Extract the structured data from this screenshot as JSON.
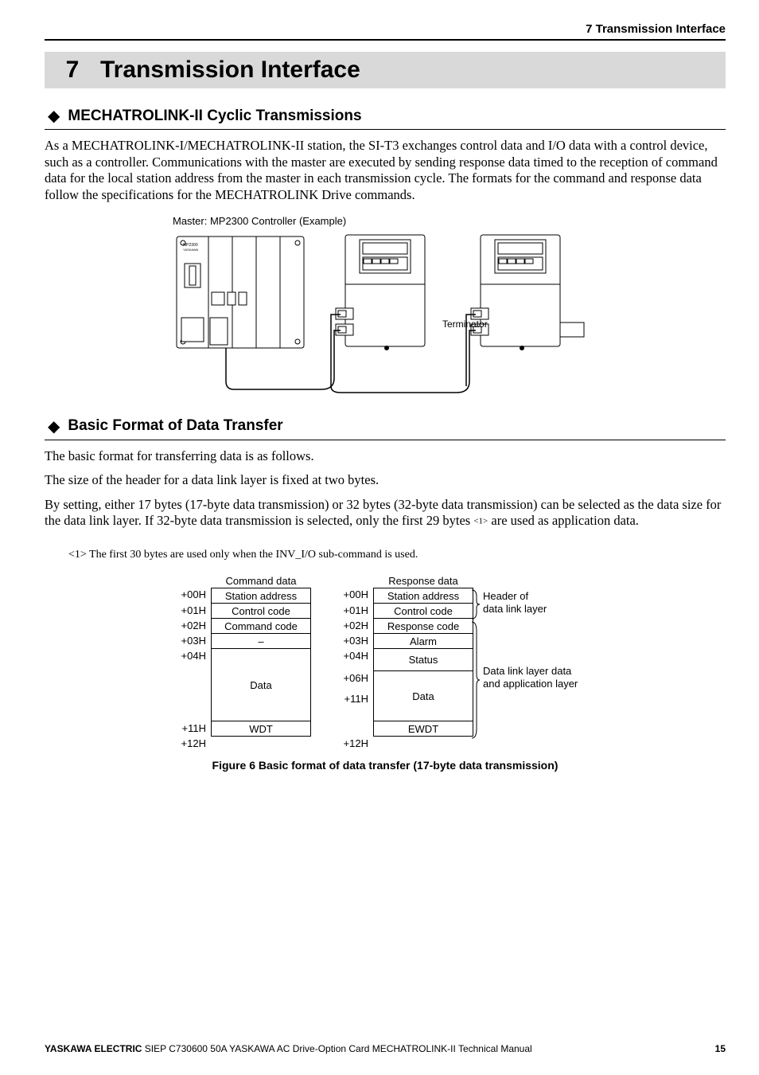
{
  "running_head": "7  Transmission Interface",
  "chapter": {
    "num": "7",
    "title": "Transmission Interface"
  },
  "sec1": {
    "title": "MECHATROLINK-II Cyclic Transmissions",
    "p1": "As a MECHATROLINK-I/MECHATROLINK-II station, the SI-T3 exchanges control data and I/O data with a control device, such as a controller. Communications with the master are executed by sending response data timed to the reception of command data for the local station address from the master in each transmission cycle. The formats for the command and response data follow the specifications for the MECHATROLINK Drive commands.",
    "diagram_label": "Master: MP2300 Controller (Example)",
    "terminator_label": "Terminator",
    "controller_text": {
      "brand": "YASKAWA",
      "model": "MP2300"
    }
  },
  "sec2": {
    "title": "Basic Format of Data Transfer",
    "p1": "The basic format for transferring data is as follows.",
    "p2": "The size of the header for a data link layer is fixed at two bytes.",
    "p3a": "By setting, either 17 bytes (17-byte data transmission) or 32 bytes (32-byte data transmission) can be selected as the data size for the data link layer.  If 32-byte data transmission is selected, only the first 29 bytes ",
    "p3_ref": "<1>",
    "p3b": " are used as application data.",
    "footnote": "<1> The first 30 bytes are used only when the INV_I/O sub-command is used."
  },
  "table": {
    "head_cmd": "Command data",
    "head_rsp": "Response data",
    "cmd_addr": [
      "+00H",
      "+01H",
      "+02H",
      "+03H",
      "+04H",
      "",
      "+11H",
      "+12H"
    ],
    "rsp_addr": [
      "+00H",
      "+01H",
      "+02H",
      "+03H",
      "+04H",
      "+06H",
      "+11H",
      "+12H"
    ],
    "cmd_cells": [
      "Station address",
      "Control code",
      "Command code",
      "–",
      "Data",
      "WDT"
    ],
    "rsp_cells": [
      "Station address",
      "Control code",
      "Response code",
      "Alarm",
      "Status",
      "Data",
      "EWDT"
    ],
    "ann1": "Header of\ndata link layer",
    "ann2": "Data link layer data\nand application layer"
  },
  "figure_caption": "Figure 6  Basic format of data transfer (17-byte data transmission)",
  "footer": {
    "brand": "YASKAWA ELECTRIC",
    "rest": " SIEP C730600 50A YASKAWA AC Drive-Option Card MECHATROLINK-II Technical Manual",
    "page": "15"
  }
}
